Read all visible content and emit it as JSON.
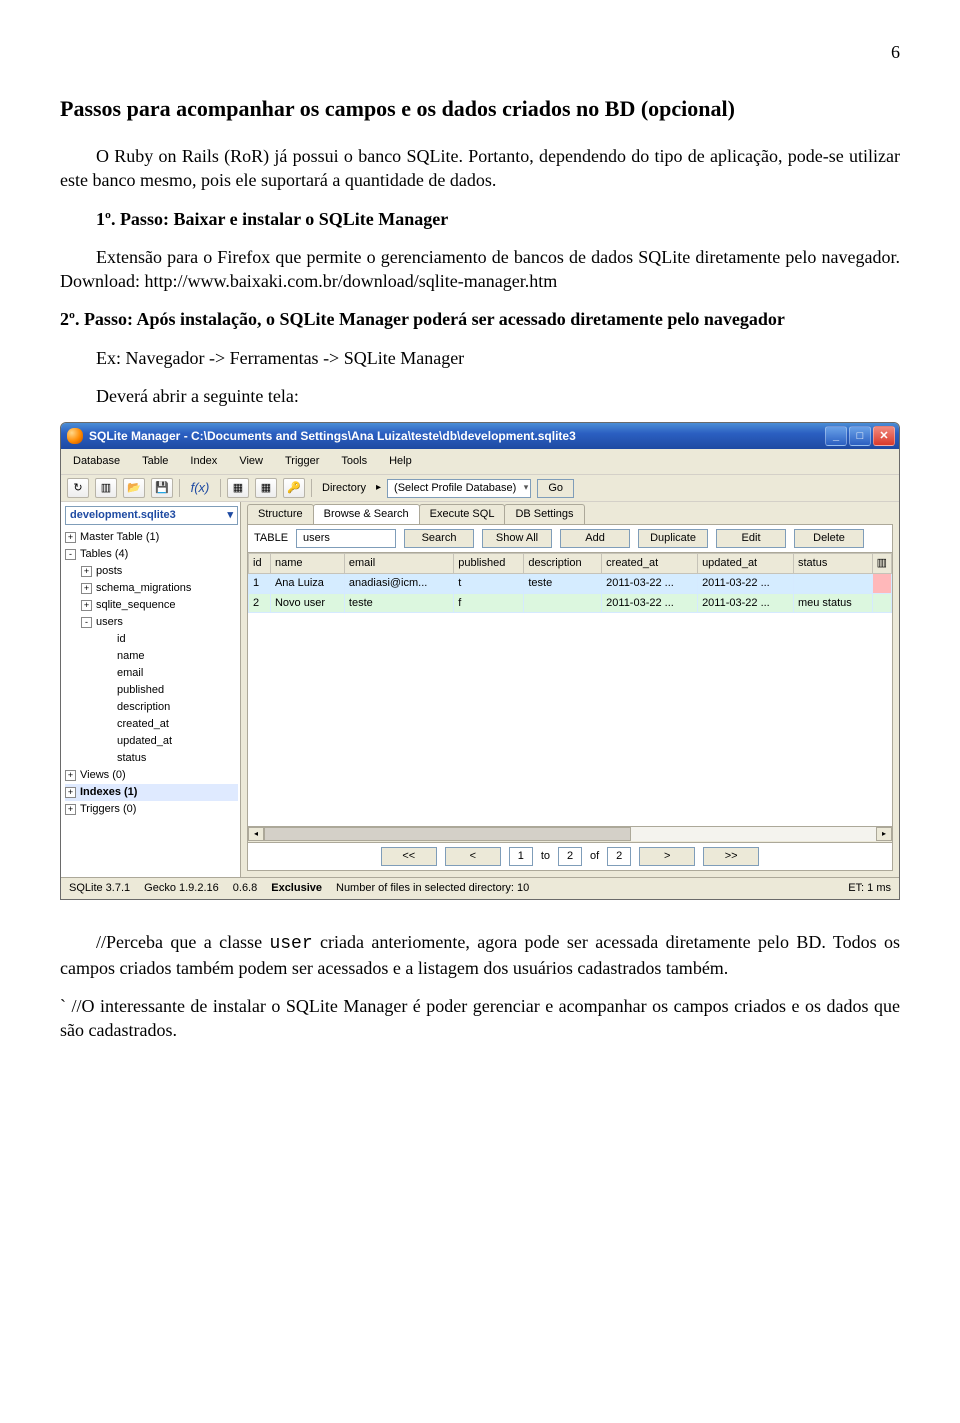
{
  "page_number": "6",
  "heading": "Passos para acompanhar os campos e os dados criados no BD (opcional)",
  "para1": "O Ruby on Rails (RoR) já possui o banco SQLite. Portanto, dependendo do tipo de aplicação, pode-se utilizar este banco mesmo, pois ele suportará a quantidade de dados.",
  "step1": "1º. Passo: Baixar e instalar o SQLite Manager",
  "para2": "Extensão para o Firefox que permite o gerenciamento de bancos de dados SQLite diretamente pelo navegador. Download: http://www.baixaki.com.br/download/sqlite-manager.htm",
  "step2": "2º. Passo: Após instalação, o SQLite Manager poderá ser acessado diretamente pelo navegador",
  "para3": "Ex: Navegador -> Ferramentas -> SQLite Manager",
  "para4": "Deverá abrir a seguinte tela:",
  "para5_prefix": "//Perceba que a classe ",
  "para5_code": "user",
  "para5_suffix": " criada anteriomente, agora pode ser acessada diretamente pelo BD. Todos os campos criados também podem ser acessados e a listagem dos usuários cadastrados também.",
  "para6": "`      //O interessante de instalar o SQLite Manager é poder gerenciar e acompanhar os campos criados e os dados que são cadastrados.",
  "app": {
    "title": "SQLite Manager - C:\\Documents and Settings\\Ana Luiza\\teste\\db\\development.sqlite3",
    "menus": [
      "Database",
      "Table",
      "Index",
      "View",
      "Trigger",
      "Tools",
      "Help"
    ],
    "toolbar": {
      "directory_label": "Directory",
      "profile": "(Select Profile Database)",
      "go": "Go",
      "fx": "f(x)"
    },
    "sidebar": {
      "db": "development.sqlite3",
      "master": "Master Table (1)",
      "tables": "Tables (4)",
      "items": [
        "posts",
        "schema_migrations",
        "sqlite_sequence",
        "users"
      ],
      "user_cols": [
        "id",
        "name",
        "email",
        "published",
        "description",
        "created_at",
        "updated_at",
        "status"
      ],
      "views": "Views (0)",
      "indexes": "Indexes (1)",
      "triggers": "Triggers (0)"
    },
    "tabs": [
      "Structure",
      "Browse & Search",
      "Execute SQL",
      "DB Settings"
    ],
    "browse": {
      "table_label": "TABLE",
      "table_value": "users",
      "buttons": {
        "search": "Search",
        "showall": "Show All",
        "add": "Add",
        "duplicate": "Duplicate",
        "edit": "Edit",
        "delete": "Delete"
      },
      "columns": [
        "id",
        "name",
        "email",
        "published",
        "description",
        "created_at",
        "updated_at",
        "status"
      ],
      "rows": [
        {
          "id": "1",
          "name": "Ana Luiza",
          "email": "anadiasi@icm...",
          "published": "t",
          "description": "teste",
          "created_at": "2011-03-22 ...",
          "updated_at": "2011-03-22 ...",
          "status": ""
        },
        {
          "id": "2",
          "name": "Novo user",
          "email": "teste",
          "published": "f",
          "description": "",
          "created_at": "2011-03-22 ...",
          "updated_at": "2011-03-22 ...",
          "status": "meu status"
        }
      ]
    },
    "pager": {
      "first": "<<",
      "prev": "<",
      "from": "1",
      "to_lbl": "to",
      "to": "2",
      "of_lbl": "of",
      "total": "2",
      "next": ">",
      "last": ">>"
    },
    "status": {
      "ver": "SQLite 3.7.1",
      "gecko": "Gecko 1.9.2.16",
      "ext": "0.6.8",
      "mode": "Exclusive",
      "files": "Number of files in selected directory: 10",
      "et": "ET: 1 ms"
    }
  }
}
